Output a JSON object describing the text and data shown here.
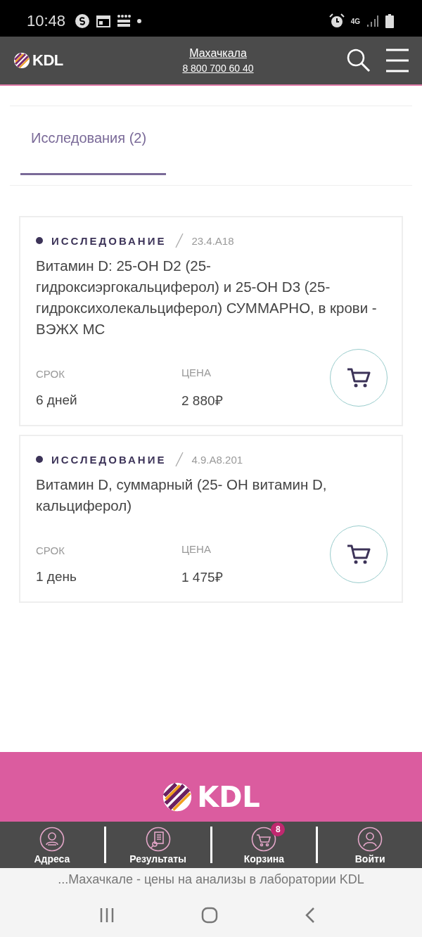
{
  "status_bar": {
    "time": "10:48",
    "network": "4G"
  },
  "header": {
    "logo": "KDL",
    "city": "Махачкала",
    "phone": "8 800 700 60 40"
  },
  "tabs": [
    {
      "label": "Исследования (2)",
      "selected": true
    }
  ],
  "cards": [
    {
      "tag": "ИССЛЕДОВАНИЕ",
      "code": "23.4.А18",
      "title": "Витамин D: 25-ОН D2 (25-гидроксиэргокальциферол) и 25-ОН D3 (25-гидроксихолекальциферол) СУММАРНО, в крови - ВЭЖХ МС",
      "term_label": "СРОК",
      "term": "6 дней",
      "price_label": "ЦЕНА",
      "price": "2 880₽"
    },
    {
      "tag": "ИССЛЕДОВАНИЕ",
      "code": "4.9.А8.201",
      "title": "Витамин D, суммарный (25- ОН витамин D, кальциферол)",
      "term_label": "СРОК",
      "term": "1 день",
      "price_label": "ЦЕНА",
      "price": "1 475₽"
    }
  ],
  "footer": {
    "logo": "KDL"
  },
  "bottom_nav": [
    {
      "kind": "pin",
      "label": "Адреса"
    },
    {
      "kind": "doc",
      "label": "Результаты"
    },
    {
      "kind": "cart",
      "label": "Корзина",
      "badge": "8"
    },
    {
      "kind": "user",
      "label": "Войти"
    }
  ],
  "browser_title": "...Махачкале - цены на анализы в лаборатории KDL"
}
